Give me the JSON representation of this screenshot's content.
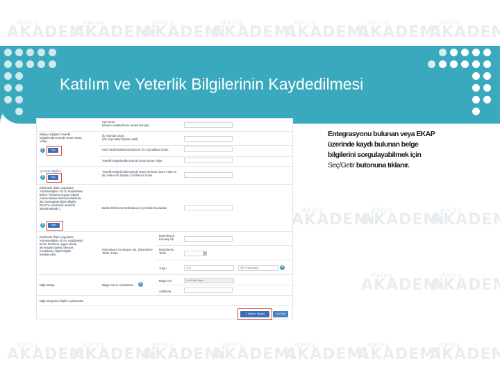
{
  "watermark": {
    "small": "daisy",
    "text": "AKADEMi"
  },
  "slide_title": "Katılım ve Yeterlik Bilgilerinin Kaydedilmesi",
  "note": {
    "line1": "Entegrasyonu bulunan veya EKAP",
    "line2": "üzerinde kaydı bulunan belge",
    "line3": "bilgilerini sorgulayabilmek için",
    "line4_normal": "Seç/Getir",
    "line4_bold": " butonuna tıklanır."
  },
  "form": {
    "cari_oran_1": "Cari Oran",
    "cari_oran_2": "(Dönen Varlıklar/Kısa Vadeli Borçlar)",
    "bilanco_1": "Bilanço Bilgileri (Yeterlik",
    "bilanco_2": "Değerlendirmesinde Esas Alınan",
    "bilanco_3": "Yıllar)",
    "oz_kaynak_1": "Öz Kaynak Oranı",
    "oz_kaynak_2": "(Öz Kaynaklar/Toplam Aktif)",
    "kisa_vade": "Kısa Vadeli Banka Borçlarının Öz Kaynaklara Oranı",
    "yeterlik_yillar": "Yeterlik Değerlendirmesinde Esas Alınan Yıllar",
    "is_hacmi": "İş Hacmi Bilgileri",
    "is_hacmi_1": "Yeterlik Değerlendirmesinde Esas Alınmak Üzere Yıllar ve",
    "is_hacmi_2": "Bu Yıllara Ait Toplam Ciro/Fatura Tutarı",
    "sec_label": "Seç",
    "getir_label": "Getir",
    "elek_1": "Elektronik İhale Uygulama",
    "elek_2": "Yönetmeliğinin 20 nci Maddesinin",
    "elek_3": "Birinci Fıkrasına Uygun Olarak",
    "elek_4": "Alınan Banka Referans Mektubu",
    "elek_5": "(Bu mektuplara ilişkin bilgiler",
    "elek_6": "EKAP'ın elektronik ortamda",
    "elek_7": "aktarılmaktadır.)",
    "banka_ref": "Banka Referans Mektubunun Ayrıt Edici Numarası",
    "elek2_1": "Elektronik İhale Uygulama",
    "elek2_2": "Yönetmeliğinin 20 nci maddesinin",
    "elek2_3": "birinci fıkrasına uygun olarak",
    "elek2_4": "alınmayan banka referans",
    "elek2_5": "mektubuna ilişkin bilgiler",
    "elek2_6": "belirtilecektir.",
    "duzenleyen_1": "Düzenleyen",
    "duzenleyen_2": "Kuruluş Adı",
    "duzenleyen_kurulus": "Düzenleyen Kuruluşun Adı, Düzenleme",
    "tarih_tutar": "Tarihi, Tutarı",
    "duzenleme_1": "Düzenleme",
    "duzenleme_2": "Tarihi",
    "tutar": "Tutarı",
    "tutar_value": "0,00",
    "currency": "TRY (Türk Lirası)",
    "diger_belge": "Diğer Belge",
    "belge_adi_aciklama": "Belge Adı ve Açıklaması",
    "belge_adi": "Belge Adı",
    "belge_placeholder": "Yeni Diğer Belge",
    "aciklama": "Açıklama",
    "diger_aciklamalar": "Diğer Belgelere İlişkin Açıklamalar",
    "save_button": "✓ Bilgileri Kaydet",
    "back_button": "Geri Dön"
  },
  "colors": {
    "banner": "#3aa9bd",
    "highlight": "#e0413a",
    "button": "#3a6fb5"
  }
}
